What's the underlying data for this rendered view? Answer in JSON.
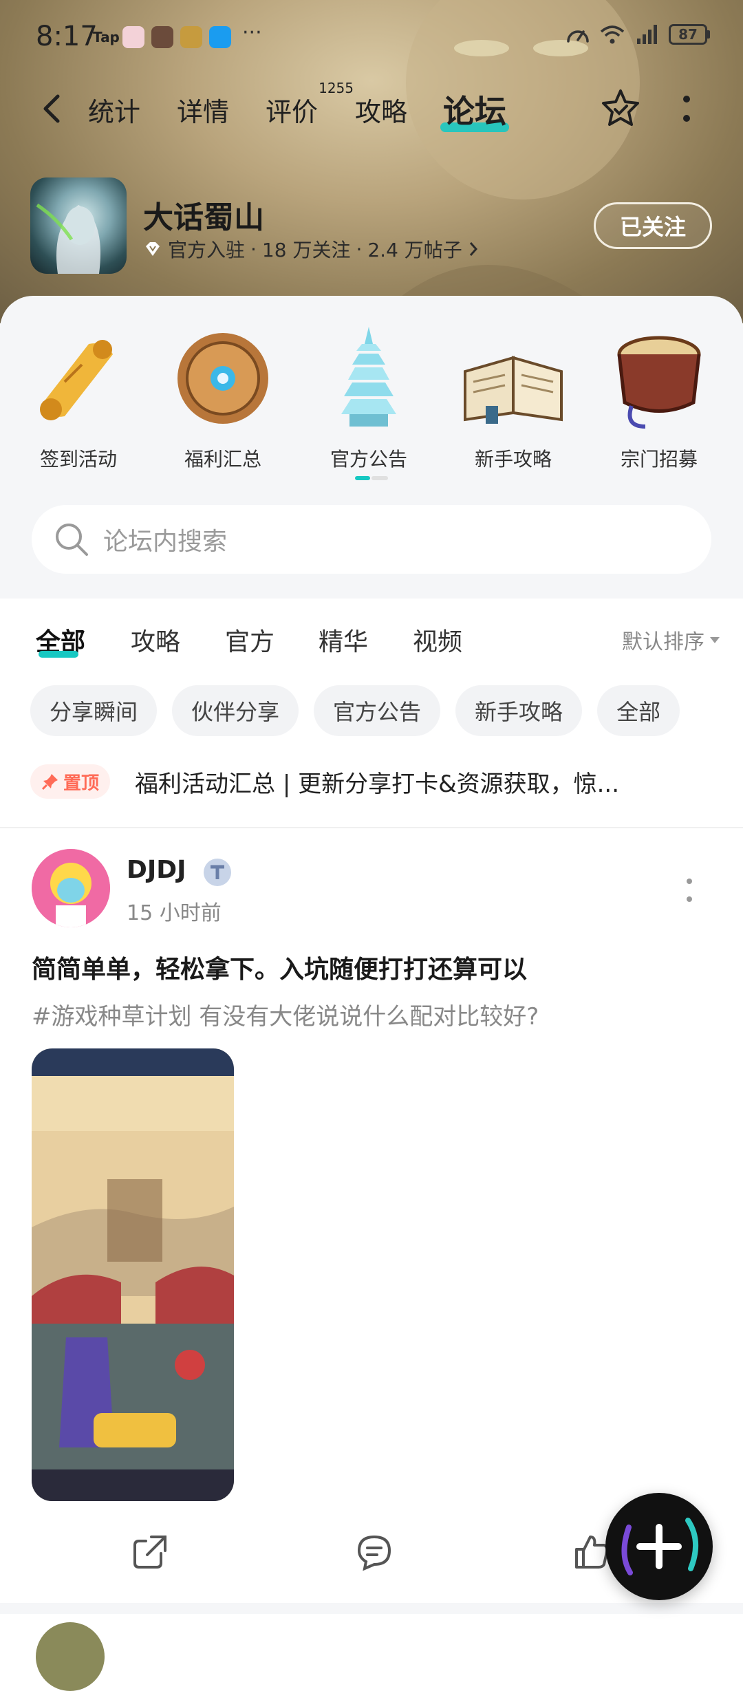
{
  "status_bar": {
    "time": "8:17",
    "tap_label": "Tap",
    "more": "···",
    "battery": "87",
    "icons": [
      "speed-icon",
      "wifi-icon",
      "signal-icon",
      "battery-icon"
    ]
  },
  "nav": {
    "tabs": [
      {
        "label": "统计"
      },
      {
        "label": "详情"
      },
      {
        "label": "评价",
        "badge": "1255"
      },
      {
        "label": "攻略"
      },
      {
        "label": "论坛",
        "active": true
      }
    ]
  },
  "game": {
    "name": "大话蜀山",
    "official": "官方入驻",
    "followers": "18 万关注",
    "posts": "2.4 万帖子",
    "follow_button": "已关注"
  },
  "categories": [
    {
      "label": "签到活动"
    },
    {
      "label": "福利汇总"
    },
    {
      "label": "官方公告"
    },
    {
      "label": "新手攻略"
    },
    {
      "label": "宗门招募"
    }
  ],
  "search": {
    "placeholder": "论坛内搜索"
  },
  "feed": {
    "tabs": [
      {
        "label": "全部",
        "active": true
      },
      {
        "label": "攻略"
      },
      {
        "label": "官方"
      },
      {
        "label": "精华"
      },
      {
        "label": "视频"
      }
    ],
    "sort": "默认排序",
    "chips": [
      "分享瞬间",
      "伙伴分享",
      "官方公告",
      "新手攻略",
      "全部"
    ],
    "pinned": {
      "tag": "置顶",
      "text": "福利活动汇总 | 更新分享打卡&资源获取，惊..."
    }
  },
  "post": {
    "username": "DJDJ",
    "time": "15 小时前",
    "title": "简简单单，轻松拿下。入坑随便打打还算可以",
    "body": "#游戏种草计划 有没有大佬说说什么配对比较好?"
  },
  "colors": {
    "accent": "#17c8c2",
    "pinned": "#ff6b57"
  }
}
